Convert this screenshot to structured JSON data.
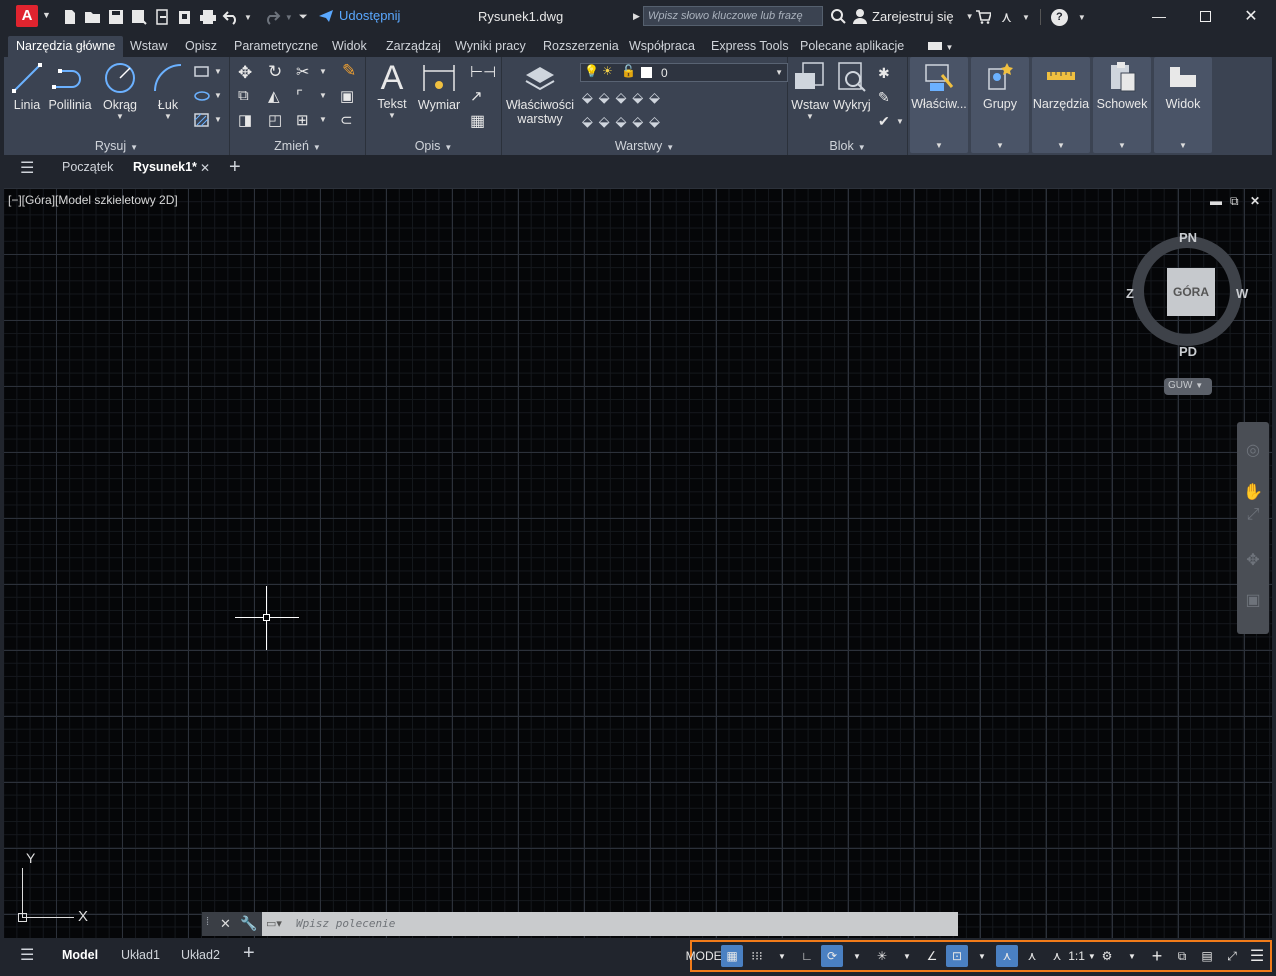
{
  "app": {
    "logo_letter": "A",
    "document_title": "Rysunek1.dwg",
    "share_label": "Udostępnij",
    "search_placeholder": "Wpisz słowo kluczowe lub frazę",
    "user_label": "Zarejestruj się",
    "help_label": "?"
  },
  "ribbon_tabs": [
    "Narzędzia główne",
    "Wstaw",
    "Opisz",
    "Parametryczne",
    "Widok",
    "Zarządzaj",
    "Wyniki pracy",
    "Rozszerzenia",
    "Współpraca",
    "Express Tools",
    "Polecane aplikacje"
  ],
  "ribbon": {
    "draw": {
      "label": "Rysuj",
      "tools": [
        "Linia",
        "Polilinia",
        "Okrąg",
        "Łuk"
      ]
    },
    "modify": {
      "label": "Zmień"
    },
    "annotation": {
      "label": "Opis",
      "tools": [
        "Tekst",
        "Wymiar"
      ]
    },
    "layers": {
      "label": "Warstwy",
      "properties_line1": "Właściwości",
      "properties_line2": "warstwy",
      "current_layer": "0"
    },
    "block": {
      "label": "Blok",
      "tools": [
        "Wstaw",
        "Wykryj"
      ]
    },
    "collapsed_panels": [
      "Właściw...",
      "Grupy",
      "Narzędzia",
      "Schowek",
      "Widok"
    ]
  },
  "file_tabs": {
    "start": "Początek",
    "active": "Rysunek1*"
  },
  "viewport": {
    "label": "[−][Góra][Model szkieletowy 2D]",
    "viewcube": {
      "face": "GÓRA",
      "north": "PN",
      "south": "PD",
      "east": "W",
      "west": "Z",
      "ucs": "GUW"
    },
    "ucs_x": "X",
    "ucs_y": "Y"
  },
  "command_line": {
    "placeholder": "Wpisz polecenie"
  },
  "layout_tabs": [
    "Model",
    "Układ1",
    "Układ2"
  ],
  "status": {
    "model": "MODEL",
    "scale": "1:1"
  },
  "colors": {
    "accent": "#4a80c2",
    "highlight_border": "#f27c1a",
    "logo": "#e0242f",
    "share": "#5aa8ff"
  }
}
